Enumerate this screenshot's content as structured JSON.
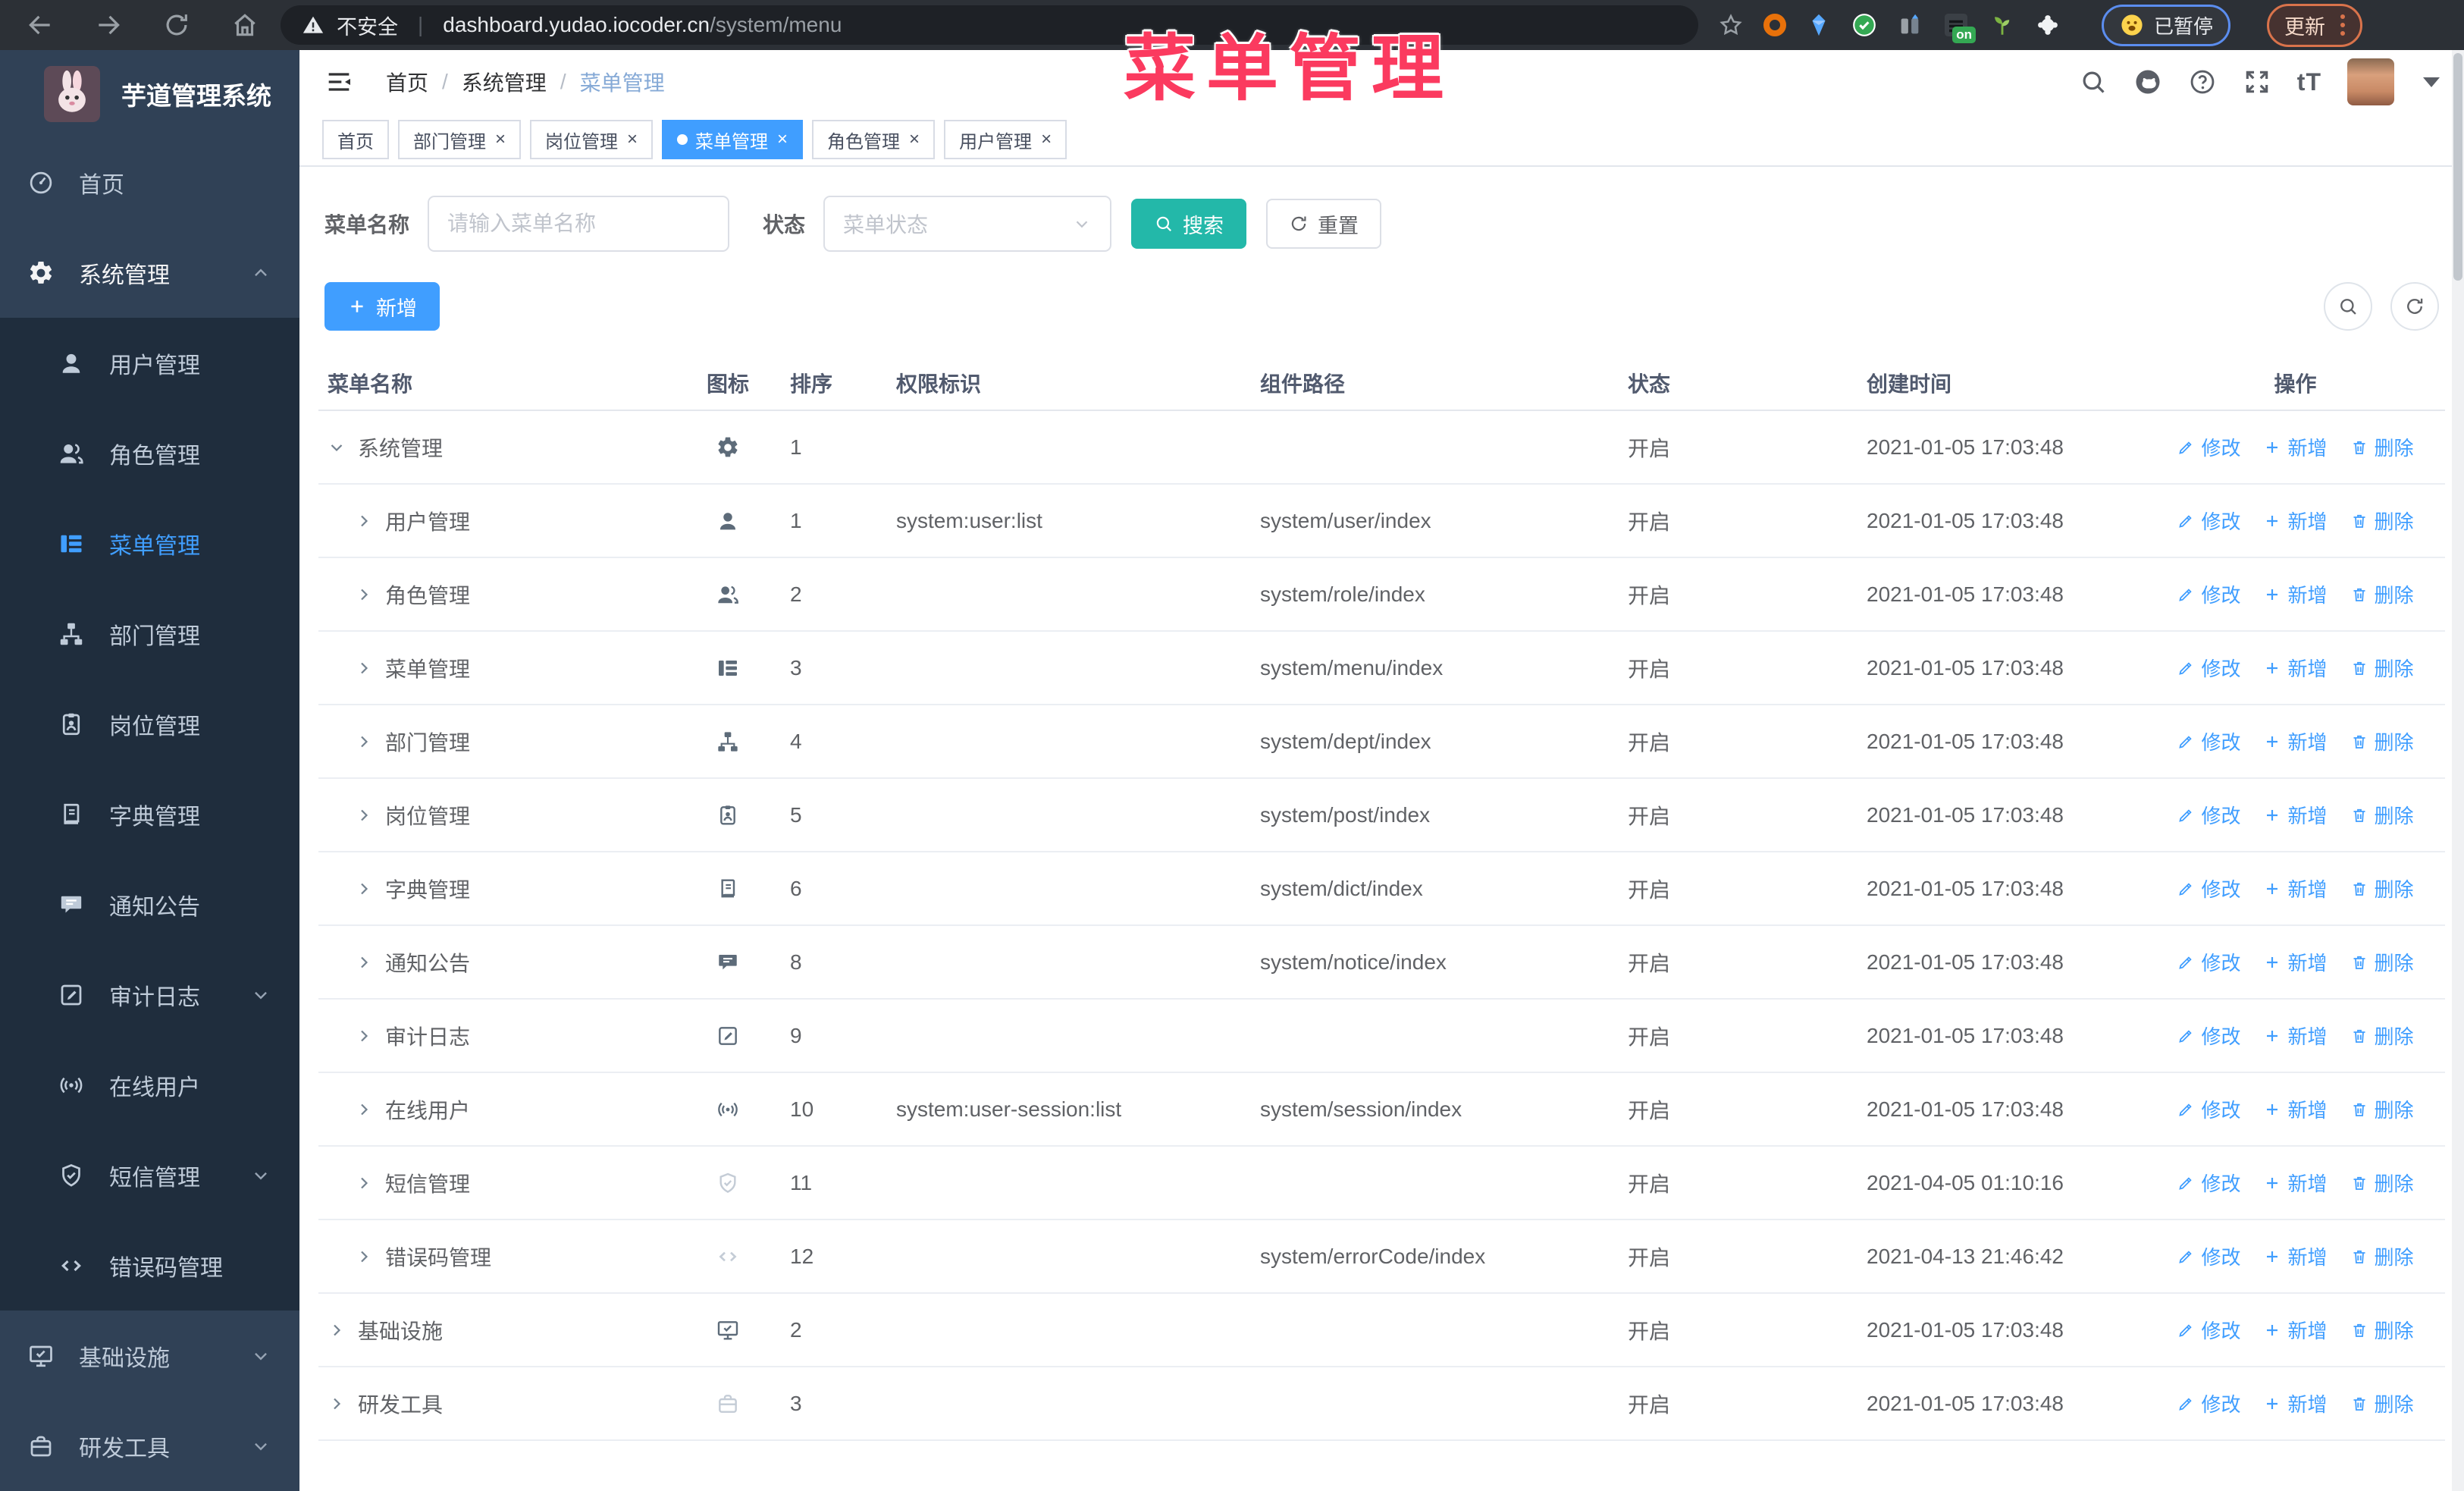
{
  "browser": {
    "security_label": "不安全",
    "url_host": "dashboard.yudao.iocoder.cn",
    "url_path": "/system/menu",
    "extension_badge": "on",
    "paused_badge": "已暂停",
    "update_button": "更新"
  },
  "watermark": "菜单管理",
  "sidebar": {
    "logo_title": "芋道管理系统",
    "items": [
      {
        "id": "home",
        "label": "首页",
        "icon": "dashboard-icon",
        "level": "top"
      },
      {
        "id": "system-mgmt",
        "label": "系统管理",
        "icon": "gear-icon",
        "level": "top",
        "expanded": true
      },
      {
        "id": "user-mgmt",
        "label": "用户管理",
        "icon": "user-icon",
        "level": "sub"
      },
      {
        "id": "role-mgmt",
        "label": "角色管理",
        "icon": "users-icon",
        "level": "sub"
      },
      {
        "id": "menu-mgmt",
        "label": "菜单管理",
        "icon": "tree-table-icon",
        "level": "sub",
        "active": true
      },
      {
        "id": "dept-mgmt",
        "label": "部门管理",
        "icon": "org-tree-icon",
        "level": "sub"
      },
      {
        "id": "post-mgmt",
        "label": "岗位管理",
        "icon": "id-badge-icon",
        "level": "sub"
      },
      {
        "id": "dict-mgmt",
        "label": "字典管理",
        "icon": "dictionary-icon",
        "level": "sub"
      },
      {
        "id": "notice",
        "label": "通知公告",
        "icon": "announcement-icon",
        "level": "sub"
      },
      {
        "id": "audit-log",
        "label": "审计日志",
        "icon": "audit-log-icon",
        "level": "sub",
        "collapsible": true
      },
      {
        "id": "online-user",
        "label": "在线用户",
        "icon": "online-user-icon",
        "level": "sub"
      },
      {
        "id": "sms-mgmt",
        "label": "短信管理",
        "icon": "shield-check-icon",
        "level": "sub",
        "collapsible": true
      },
      {
        "id": "error-code-mgmt",
        "label": "错误码管理",
        "icon": "code-icon",
        "level": "sub"
      },
      {
        "id": "infrastructure",
        "label": "基础设施",
        "icon": "monitor-icon",
        "level": "top",
        "collapsible": true
      },
      {
        "id": "dev-tools",
        "label": "研发工具",
        "icon": "toolbox-icon",
        "level": "top",
        "collapsible": true
      }
    ]
  },
  "header": {
    "breadcrumb": [
      "首页",
      "系统管理",
      "菜单管理"
    ]
  },
  "tabs": [
    {
      "id": "home",
      "label": "首页",
      "closable": false,
      "active": false
    },
    {
      "id": "dept",
      "label": "部门管理",
      "closable": true,
      "active": false
    },
    {
      "id": "post",
      "label": "岗位管理",
      "closable": true,
      "active": false
    },
    {
      "id": "menu",
      "label": "菜单管理",
      "closable": true,
      "active": true
    },
    {
      "id": "role",
      "label": "角色管理",
      "closable": true,
      "active": false
    },
    {
      "id": "user",
      "label": "用户管理",
      "closable": true,
      "active": false
    }
  ],
  "filters": {
    "name_label": "菜单名称",
    "name_placeholder": "请输入菜单名称",
    "status_label": "状态",
    "status_placeholder": "菜单状态",
    "search_label": "搜索",
    "reset_label": "重置"
  },
  "toolbar": {
    "add_label": "新增"
  },
  "table": {
    "columns": [
      {
        "id": "name",
        "label": "菜单名称"
      },
      {
        "id": "icon",
        "label": "图标"
      },
      {
        "id": "sort",
        "label": "排序"
      },
      {
        "id": "perm",
        "label": "权限标识"
      },
      {
        "id": "path",
        "label": "组件路径"
      },
      {
        "id": "status",
        "label": "状态"
      },
      {
        "id": "time",
        "label": "创建时间"
      },
      {
        "id": "ops",
        "label": "操作"
      }
    ],
    "op_labels": {
      "edit": "修改",
      "add": "新增",
      "delete": "删除"
    },
    "rows": [
      {
        "name": "系统管理",
        "icon": "gear-icon",
        "sort": "1",
        "perm": "",
        "path": "",
        "status": "开启",
        "time": "2021-01-05 17:03:48",
        "level": 0,
        "expanded": true
      },
      {
        "name": "用户管理",
        "icon": "user-icon",
        "sort": "1",
        "perm": "system:user:list",
        "path": "system/user/index",
        "status": "开启",
        "time": "2021-01-05 17:03:48",
        "level": 1
      },
      {
        "name": "角色管理",
        "icon": "users-icon",
        "sort": "2",
        "perm": "",
        "path": "system/role/index",
        "status": "开启",
        "time": "2021-01-05 17:03:48",
        "level": 1
      },
      {
        "name": "菜单管理",
        "icon": "tree-table-icon",
        "sort": "3",
        "perm": "",
        "path": "system/menu/index",
        "status": "开启",
        "time": "2021-01-05 17:03:48",
        "level": 1
      },
      {
        "name": "部门管理",
        "icon": "org-tree-icon",
        "sort": "4",
        "perm": "",
        "path": "system/dept/index",
        "status": "开启",
        "time": "2021-01-05 17:03:48",
        "level": 1
      },
      {
        "name": "岗位管理",
        "icon": "id-badge-icon",
        "sort": "5",
        "perm": "",
        "path": "system/post/index",
        "status": "开启",
        "time": "2021-01-05 17:03:48",
        "level": 1
      },
      {
        "name": "字典管理",
        "icon": "dictionary-icon",
        "sort": "6",
        "perm": "",
        "path": "system/dict/index",
        "status": "开启",
        "time": "2021-01-05 17:03:48",
        "level": 1
      },
      {
        "name": "通知公告",
        "icon": "announcement-icon",
        "sort": "8",
        "perm": "",
        "path": "system/notice/index",
        "status": "开启",
        "time": "2021-01-05 17:03:48",
        "level": 1
      },
      {
        "name": "审计日志",
        "icon": "audit-log-icon",
        "sort": "9",
        "perm": "",
        "path": "",
        "status": "开启",
        "time": "2021-01-05 17:03:48",
        "level": 1
      },
      {
        "name": "在线用户",
        "icon": "online-user-icon",
        "sort": "10",
        "perm": "system:user-session:list",
        "path": "system/session/index",
        "status": "开启",
        "time": "2021-01-05 17:03:48",
        "level": 1
      },
      {
        "name": "短信管理",
        "icon": "shield-check-icon",
        "sort": "11",
        "perm": "",
        "path": "",
        "status": "开启",
        "time": "2021-04-05 01:10:16",
        "level": 1,
        "icon_light": true
      },
      {
        "name": "错误码管理",
        "icon": "code-icon",
        "sort": "12",
        "perm": "",
        "path": "system/errorCode/index",
        "status": "开启",
        "time": "2021-04-13 21:46:42",
        "level": 1,
        "icon_light": true
      },
      {
        "name": "基础设施",
        "icon": "monitor-icon",
        "sort": "2",
        "perm": "",
        "path": "",
        "status": "开启",
        "time": "2021-01-05 17:03:48",
        "level": 0,
        "expanded": false
      },
      {
        "name": "研发工具",
        "icon": "toolbox-icon",
        "sort": "3",
        "perm": "",
        "path": "",
        "status": "开启",
        "time": "2021-01-05 17:03:48",
        "level": 0,
        "expanded": false,
        "icon_light": true
      }
    ]
  },
  "colors": {
    "primary": "#409eff",
    "search_button": "#23b8a9",
    "sidebar_bg": "#304156",
    "submenu_bg": "#1f2d3d",
    "watermark": "#fb3a5f",
    "active_tab": "#409eff"
  }
}
